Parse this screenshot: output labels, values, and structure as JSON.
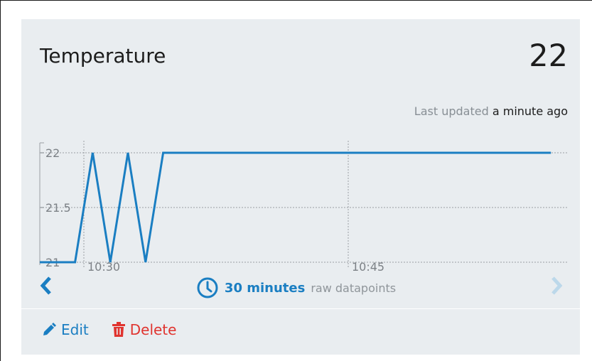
{
  "widget": {
    "title": "Temperature",
    "current_value": "22",
    "updated_label": "Last updated",
    "updated_ago": "a minute ago"
  },
  "controls": {
    "range_value": "30 minutes",
    "range_mode": "raw datapoints",
    "prev_icon": "chevron-left-icon",
    "next_icon": "chevron-right-icon",
    "clock_icon": "clock-icon"
  },
  "actions": {
    "edit_label": "Edit",
    "delete_label": "Delete",
    "edit_icon": "pencil-icon",
    "delete_icon": "trash-icon"
  },
  "colors": {
    "accent": "#1a7ec2",
    "danger": "#e0342f",
    "card_bg": "#e9edf0"
  },
  "chart_data": {
    "type": "line",
    "y_ticks": [
      "22",
      "21.5",
      "21"
    ],
    "x_ticks": [
      "10:30",
      "10:45"
    ],
    "ylim": [
      21,
      22
    ],
    "grid": true,
    "series": [
      {
        "x": [
          "10:27",
          "10:29:30",
          "10:30:30",
          "10:31:30",
          "10:32:30",
          "10:33:30",
          "10:34:30",
          "10:35:30",
          "10:56:30"
        ],
        "values": [
          21,
          21,
          22,
          21,
          22,
          21,
          22,
          22,
          22
        ]
      }
    ]
  }
}
